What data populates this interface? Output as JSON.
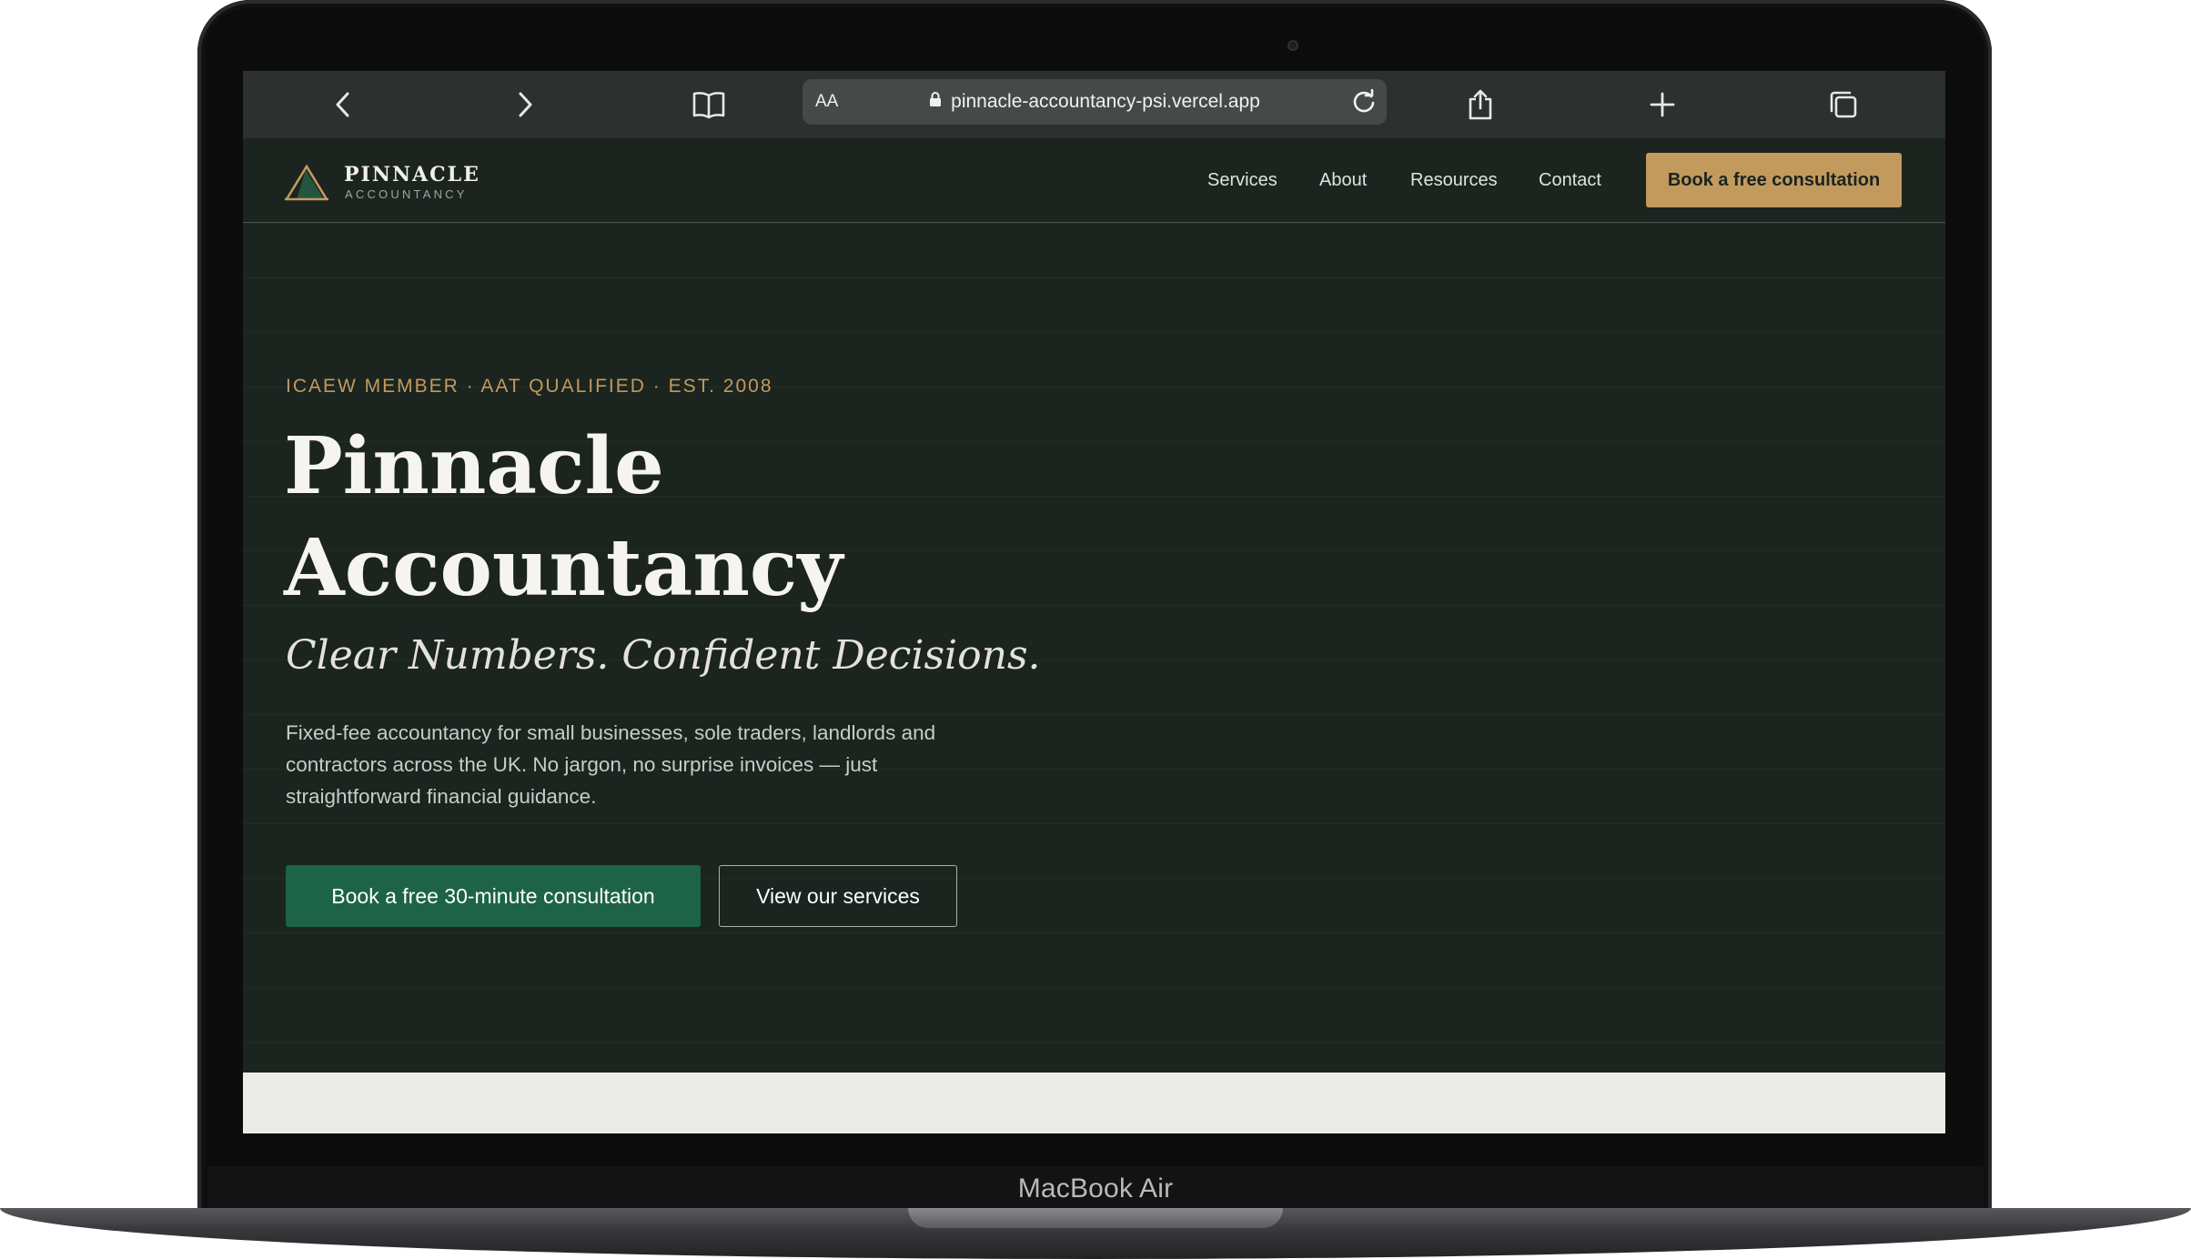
{
  "device": {
    "model_label": "MacBook Air"
  },
  "browser": {
    "text_size_label": "AA",
    "url": "pinnacle-accountancy-psi.vercel.app",
    "icons": [
      "back-icon",
      "forward-icon",
      "bookmarks-icon",
      "lock-icon",
      "reload-icon",
      "share-icon",
      "new-tab-icon",
      "tabs-icon"
    ]
  },
  "site": {
    "logo": {
      "name": "PINNACLE",
      "sub": "ACCOUNTANCY"
    },
    "nav": [
      {
        "label": "Services"
      },
      {
        "label": "About"
      },
      {
        "label": "Resources"
      },
      {
        "label": "Contact"
      }
    ],
    "header_cta": "Book a free consultation",
    "hero": {
      "eyebrow": "ICAEW MEMBER · AAT QUALIFIED · EST. 2008",
      "title_line1": "Pinnacle",
      "title_line2": "Accountancy",
      "tagline": "Clear Numbers. Confident Decisions.",
      "body": "Fixed-fee accountancy for small businesses, sole traders, landlords and contractors across the UK. No jargon, no surprise invoices — just straightforward financial guidance.",
      "primary_cta": "Book a free 30-minute consultation",
      "secondary_cta": "View our services"
    }
  },
  "colors": {
    "background": "#1b241f",
    "accent_gold": "#c39a5d",
    "primary_green": "#1d6347",
    "light_section": "#ebece8"
  }
}
